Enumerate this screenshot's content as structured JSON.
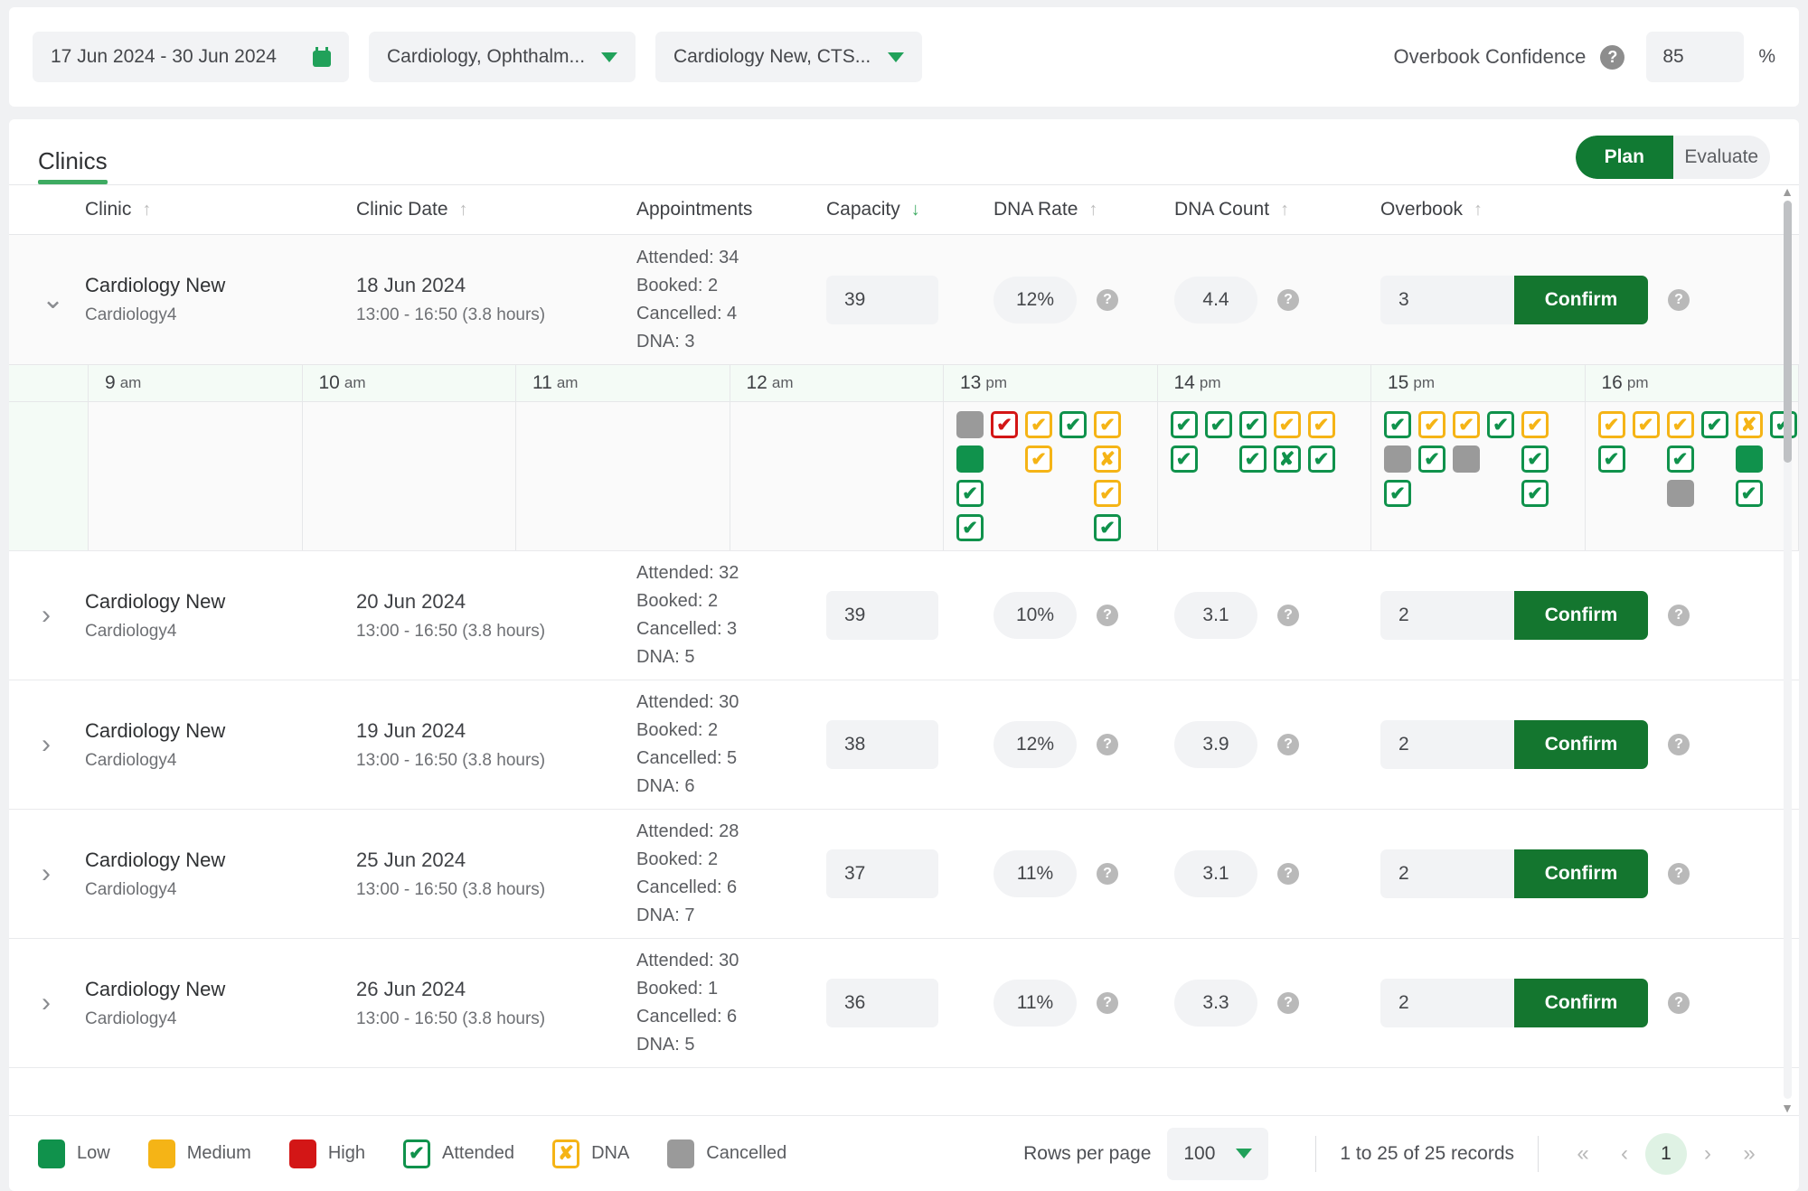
{
  "filters": {
    "date_range": "17 Jun 2024 - 30 Jun 2024",
    "specialty": "Cardiology, Ophthalm...",
    "clinic": "Cardiology New, CTS...",
    "overbook_confidence_label": "Overbook Confidence",
    "overbook_confidence_value": "85",
    "percent_symbol": "%"
  },
  "card": {
    "tab": "Clinics",
    "toggle": {
      "plan": "Plan",
      "evaluate": "Evaluate",
      "active": "Plan"
    }
  },
  "columns": [
    {
      "label": "Clinic",
      "sort": "asc",
      "active": false
    },
    {
      "label": "Clinic Date",
      "sort": "asc",
      "active": false
    },
    {
      "label": "Appointments",
      "sort": "none",
      "active": false
    },
    {
      "label": "Capacity",
      "sort": "desc",
      "active": true
    },
    {
      "label": "DNA Rate",
      "sort": "asc",
      "active": false
    },
    {
      "label": "DNA Count",
      "sort": "asc",
      "active": false
    },
    {
      "label": "Overbook",
      "sort": "asc",
      "active": false
    }
  ],
  "rows": [
    {
      "expanded": true,
      "clinic": "Cardiology New",
      "clinic_sub": "Cardiology4",
      "date": "18 Jun 2024",
      "date_sub": "13:00 - 16:50 (3.8 hours)",
      "attended": "Attended: 34",
      "booked": "Booked: 2",
      "cancelled": "Cancelled: 4",
      "dna": "DNA: 3",
      "capacity": "39",
      "dna_rate": "12%",
      "dna_count": "4.4",
      "overbook": "3",
      "confirm": "Confirm"
    },
    {
      "expanded": false,
      "clinic": "Cardiology New",
      "clinic_sub": "Cardiology4",
      "date": "20 Jun 2024",
      "date_sub": "13:00 - 16:50 (3.8 hours)",
      "attended": "Attended: 32",
      "booked": "Booked: 2",
      "cancelled": "Cancelled: 3",
      "dna": "DNA: 5",
      "capacity": "39",
      "dna_rate": "10%",
      "dna_count": "3.1",
      "overbook": "2",
      "confirm": "Confirm"
    },
    {
      "expanded": false,
      "clinic": "Cardiology New",
      "clinic_sub": "Cardiology4",
      "date": "19 Jun 2024",
      "date_sub": "13:00 - 16:50 (3.8 hours)",
      "attended": "Attended: 30",
      "booked": "Booked: 2",
      "cancelled": "Cancelled: 5",
      "dna": "DNA: 6",
      "capacity": "38",
      "dna_rate": "12%",
      "dna_count": "3.9",
      "overbook": "2",
      "confirm": "Confirm"
    },
    {
      "expanded": false,
      "clinic": "Cardiology New",
      "clinic_sub": "Cardiology4",
      "date": "25 Jun 2024",
      "date_sub": "13:00 - 16:50 (3.8 hours)",
      "attended": "Attended: 28",
      "booked": "Booked: 2",
      "cancelled": "Cancelled: 6",
      "dna": "DNA: 7",
      "capacity": "37",
      "dna_rate": "11%",
      "dna_count": "3.1",
      "overbook": "2",
      "confirm": "Confirm"
    },
    {
      "expanded": false,
      "clinic": "Cardiology New",
      "clinic_sub": "Cardiology4",
      "date": "26 Jun 2024",
      "date_sub": "13:00 - 16:50 (3.8 hours)",
      "attended": "Attended: 30",
      "booked": "Booked: 1",
      "cancelled": "Cancelled: 6",
      "dna": "DNA: 5",
      "capacity": "36",
      "dna_rate": "11%",
      "dna_count": "3.3",
      "overbook": "2",
      "confirm": "Confirm"
    }
  ],
  "timeline": {
    "hours": [
      {
        "h": "9",
        "p": "am"
      },
      {
        "h": "10",
        "p": "am"
      },
      {
        "h": "11",
        "p": "am"
      },
      {
        "h": "12",
        "p": "am"
      },
      {
        "h": "13",
        "p": "pm"
      },
      {
        "h": "14",
        "p": "pm"
      },
      {
        "h": "15",
        "p": "pm"
      },
      {
        "h": "16",
        "p": "pm"
      }
    ],
    "slots": [
      {
        "hour": "9",
        "columns": []
      },
      {
        "hour": "10",
        "columns": []
      },
      {
        "hour": "11",
        "columns": []
      },
      {
        "hour": "12",
        "columns": []
      },
      {
        "hour": "13",
        "columns": [
          [
            "cancelled",
            "low",
            "attended-green",
            "attended-green"
          ],
          [
            "attended-red"
          ],
          [
            "attended-amber",
            "attended-amber"
          ],
          [
            "attended-green"
          ],
          [
            "attended-amber",
            "dna-amber",
            "attended-amber",
            "attended-green"
          ]
        ]
      },
      {
        "hour": "14",
        "columns": [
          [
            "attended-green",
            "attended-green"
          ],
          [
            "attended-green"
          ],
          [
            "attended-green",
            "attended-green"
          ],
          [
            "attended-amber",
            "dna-green"
          ],
          [
            "attended-amber",
            "attended-green"
          ]
        ]
      },
      {
        "hour": "15",
        "columns": [
          [
            "attended-green",
            "cancelled",
            "attended-green"
          ],
          [
            "attended-amber",
            "attended-green"
          ],
          [
            "attended-amber",
            "cancelled"
          ],
          [
            "attended-green"
          ],
          [
            "attended-amber",
            "attended-green",
            "attended-green"
          ]
        ]
      },
      {
        "hour": "16",
        "columns": [
          [
            "attended-amber",
            "attended-green"
          ],
          [
            "attended-amber"
          ],
          [
            "attended-amber",
            "attended-green",
            "cancelled"
          ],
          [
            "attended-green"
          ],
          [
            "dna-amber",
            "low",
            "attended-green"
          ],
          [
            "attended-green"
          ]
        ]
      }
    ]
  },
  "legend": [
    {
      "type": "swatch-low",
      "label": "Low"
    },
    {
      "type": "swatch-med",
      "label": "Medium"
    },
    {
      "type": "swatch-high",
      "label": "High"
    },
    {
      "type": "icon-attended",
      "label": "Attended"
    },
    {
      "type": "icon-dna",
      "label": "DNA"
    },
    {
      "type": "swatch-cancelled",
      "label": "Cancelled"
    }
  ],
  "pagination": {
    "rows_per_page_label": "Rows per page",
    "rows_per_page_value": "100",
    "records": "1 to 25 of 25 records",
    "first": "«",
    "prev": "‹",
    "page": "1",
    "next": "›",
    "last": "»"
  },
  "colors": {
    "green": "#10924c",
    "dark_green": "#117a33",
    "amber": "#f5b416",
    "red": "#d31616",
    "grey": "#9a9a9a"
  }
}
